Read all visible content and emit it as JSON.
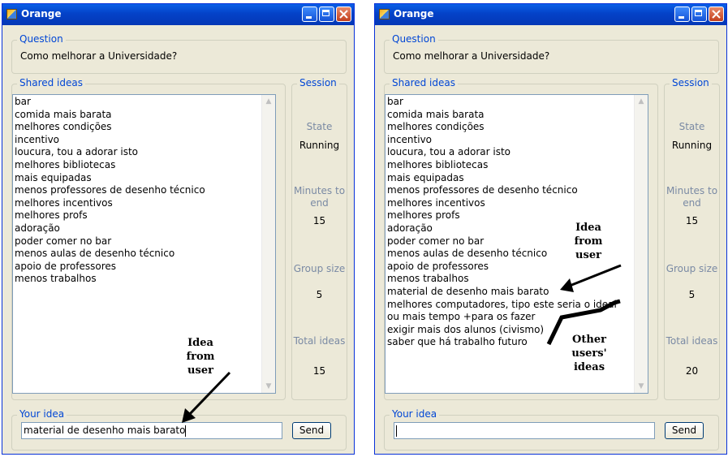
{
  "windows": [
    {
      "title": "Orange",
      "question_legend": "Question",
      "question": "Como melhorar a Universidade?",
      "ideas_legend": "Shared ideas",
      "ideas": [
        "bar",
        "comida mais barata",
        "melhores condições",
        "incentivo",
        "loucura, tou a adorar isto",
        "melhores bibliotecas",
        "mais equipadas",
        "menos professores de desenho técnico",
        "melhores incentivos",
        "melhores profs",
        "adoração",
        "poder comer no bar",
        "menos aulas de desenho técnico",
        "apoio de professores",
        "menos trabalhos"
      ],
      "session": {
        "legend": "Session",
        "state_label": "State",
        "state_value": "Running",
        "minutes_label": "Minutes to end",
        "minutes_value": "15",
        "group_label": "Group size",
        "group_value": "5",
        "total_label": "Total ideas",
        "total_value": "15"
      },
      "your_idea_legend": "Your idea",
      "your_idea_value": "material de desenho mais barato",
      "send_label": "Send",
      "annotations": [
        "Idea from user"
      ]
    },
    {
      "title": "Orange",
      "question_legend": "Question",
      "question": "Como melhorar a Universidade?",
      "ideas_legend": "Shared ideas",
      "ideas": [
        "bar",
        "comida mais barata",
        "melhores condições",
        "incentivo",
        "loucura, tou a adorar isto",
        "melhores bibliotecas",
        "mais equipadas",
        "menos professores de desenho técnico",
        "melhores incentivos",
        "melhores profs",
        "adoração",
        "poder comer no bar",
        "menos aulas de desenho técnico",
        "apoio de professores",
        "menos trabalhos",
        "material de desenho mais barato",
        "melhores computadores, tipo este seria o ideal",
        "ou mais tempo +para os fazer",
        "exigir mais dos alunos (civismo)",
        "saber que há trabalho futuro"
      ],
      "session": {
        "legend": "Session",
        "state_label": "State",
        "state_value": "Running",
        "minutes_label": "Minutes to end",
        "minutes_value": "15",
        "group_label": "Group size",
        "group_value": "5",
        "total_label": "Total ideas",
        "total_value": "20"
      },
      "your_idea_legend": "Your idea",
      "your_idea_value": "",
      "send_label": "Send",
      "annotations": [
        "Idea from user",
        "Other users' ideas"
      ]
    }
  ]
}
